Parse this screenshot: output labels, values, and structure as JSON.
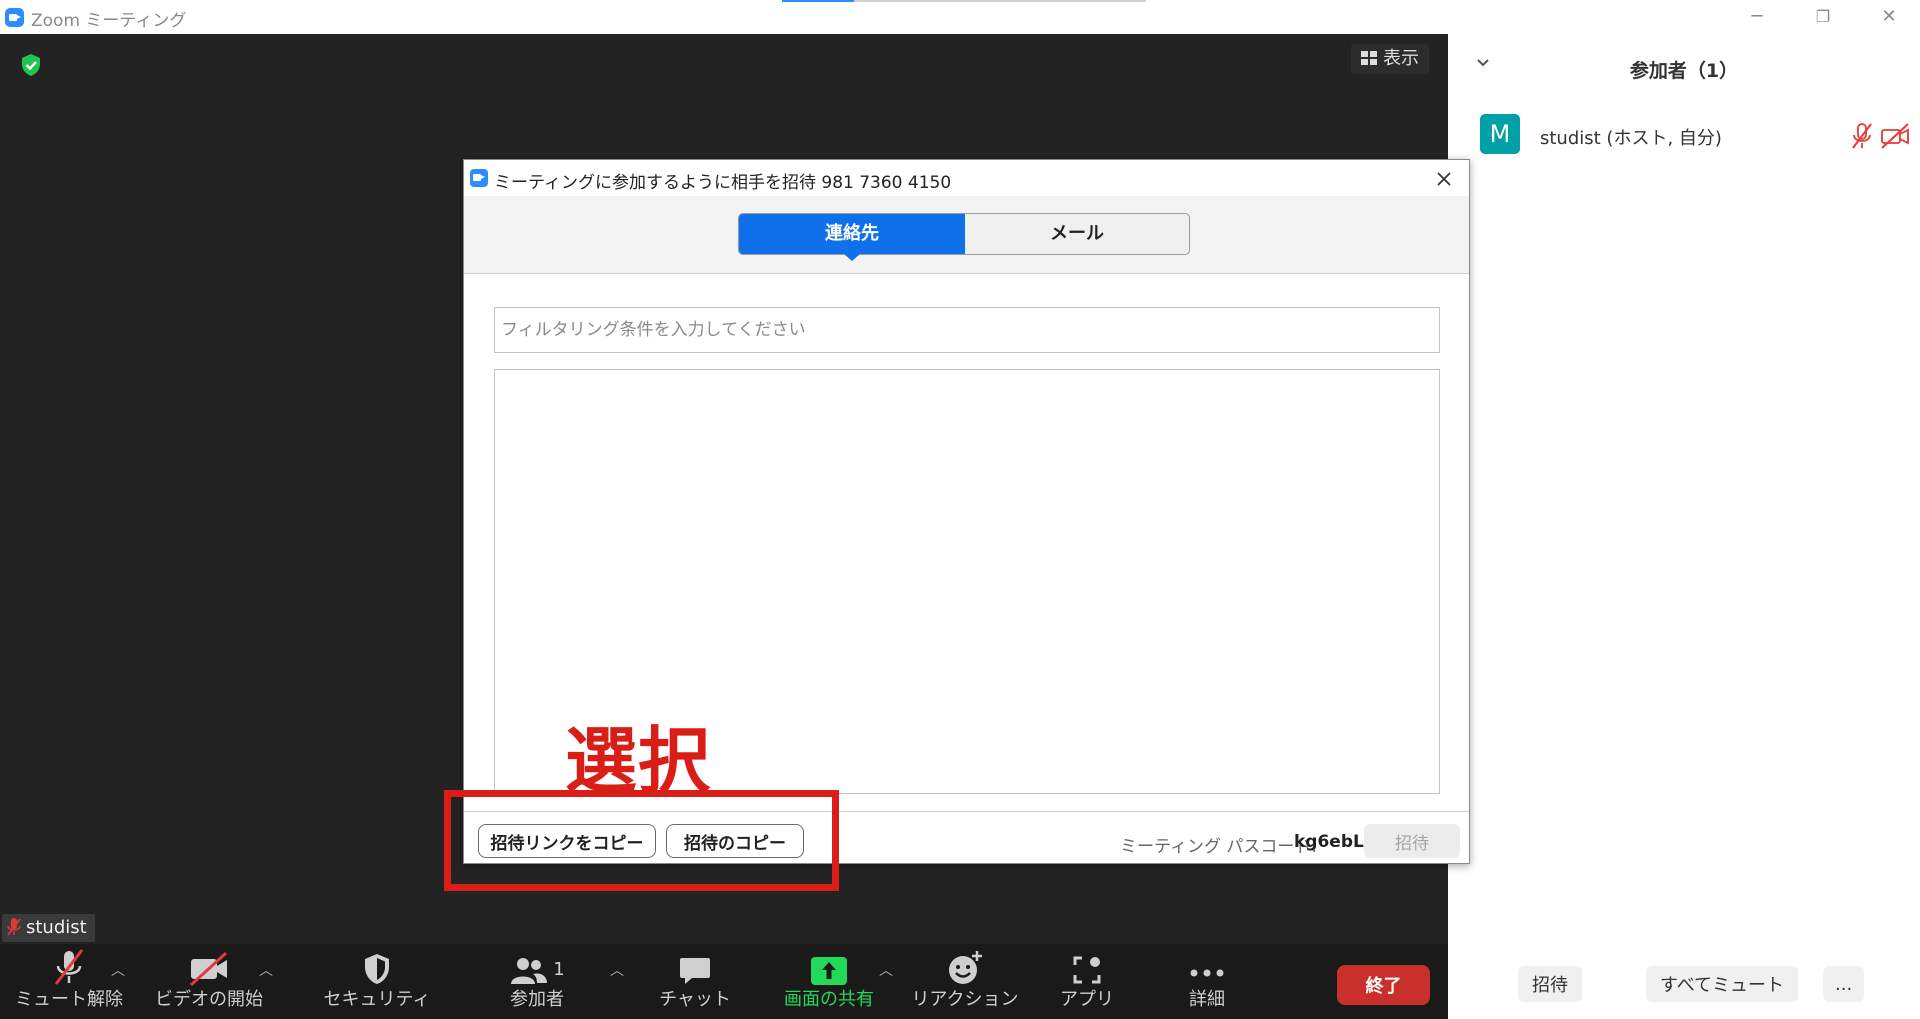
{
  "window": {
    "title": "Zoom ミーティング",
    "minimize": "─",
    "restore": "❐",
    "close": "✕"
  },
  "video": {
    "view_label": "表示",
    "self_name": "studist"
  },
  "toolbar": {
    "mute": "ミュート解除",
    "video": "ビデオの開始",
    "security": "セキュリティ",
    "participants": "参加者",
    "participants_count": "1",
    "chat": "チャット",
    "share": "画面の共有",
    "reactions": "リアクション",
    "apps": "アプリ",
    "more": "詳細",
    "end": "終了",
    "colors": {
      "share": "#23d959",
      "end": "#c9302c"
    }
  },
  "panel": {
    "title": "参加者（1）",
    "participants": [
      {
        "initial": "M",
        "name": "studist (ホスト, 自分)",
        "avatar_color": "#00a0a8"
      }
    ],
    "invite": "招待",
    "mute_all": "すべてミュート",
    "more": "..."
  },
  "dialog": {
    "title": "ミーティングに参加するように相手を招待 981 7360 4150",
    "tabs": {
      "contacts": "連絡先",
      "email": "メール"
    },
    "search_placeholder": "フィルタリング条件を入力してください",
    "copy_link": "招待リンクをコピー",
    "copy_invite": "招待のコピー",
    "passcode_label": "ミーティング パスコード:",
    "passcode": "kg6ebL",
    "invite": "招待",
    "accent": "#0e71eb"
  },
  "annotation": {
    "text": "選択",
    "color": "#d91e18"
  }
}
